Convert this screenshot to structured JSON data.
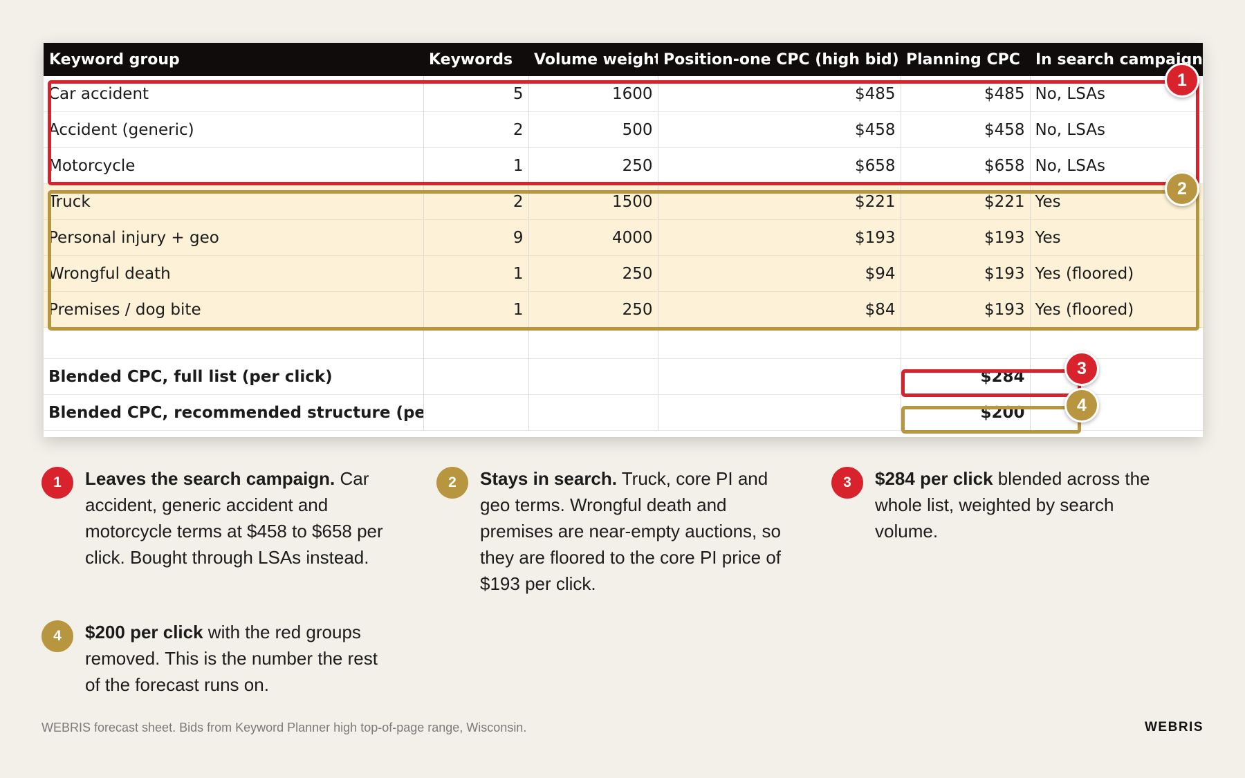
{
  "table": {
    "headers": [
      "Keyword group",
      "Keywords",
      "Volume weight",
      "Position-one CPC (high bid)",
      "Planning CPC",
      "In search campaign?"
    ],
    "rows": [
      {
        "group": "Car accident",
        "keywords": "5",
        "volume": "1600",
        "pos_cpc": "$485",
        "planning_cpc": "$485",
        "in_search": "No, LSAs"
      },
      {
        "group": "Accident (generic)",
        "keywords": "2",
        "volume": "500",
        "pos_cpc": "$458",
        "planning_cpc": "$458",
        "in_search": "No, LSAs"
      },
      {
        "group": "Motorcycle",
        "keywords": "1",
        "volume": "250",
        "pos_cpc": "$658",
        "planning_cpc": "$658",
        "in_search": "No, LSAs"
      },
      {
        "group": "Truck",
        "keywords": "2",
        "volume": "1500",
        "pos_cpc": "$221",
        "planning_cpc": "$221",
        "in_search": "Yes"
      },
      {
        "group": "Personal injury + geo",
        "keywords": "9",
        "volume": "4000",
        "pos_cpc": "$193",
        "planning_cpc": "$193",
        "in_search": "Yes"
      },
      {
        "group": "Wrongful death",
        "keywords": "1",
        "volume": "250",
        "pos_cpc": "$94",
        "planning_cpc": "$193",
        "in_search": "Yes (floored)"
      },
      {
        "group": "Premises / dog bite",
        "keywords": "1",
        "volume": "250",
        "pos_cpc": "$84",
        "planning_cpc": "$193",
        "in_search": "Yes (floored)"
      }
    ],
    "totals": [
      {
        "label": "Blended CPC, full list (per click)",
        "value": "$284"
      },
      {
        "label": "Blended CPC, recommended structure (per click)",
        "value": "$200"
      }
    ]
  },
  "markers": [
    "1",
    "2",
    "3",
    "4"
  ],
  "notes": [
    {
      "num": "1",
      "lead": "Leaves the search campaign.",
      "body": " Car accident, generic accident and motorcycle terms at $458 to $658 per click. Bought through LSAs instead."
    },
    {
      "num": "2",
      "lead": "Stays in search.",
      "body": " Truck, core PI and geo terms. Wrongful death and premises are near-empty auctions, so they are floored to the core PI price of $193 per click."
    },
    {
      "num": "3",
      "lead": "$284 per click",
      "body": " blended across the whole list, weighted by search volume."
    },
    {
      "num": "4",
      "lead": "$200 per click",
      "body": " with the red groups removed. This is the number the rest of the forecast runs on."
    }
  ],
  "footer": {
    "caption": "WEBRIS forecast sheet. Bids from Keyword Planner high top-of-page range, Wisconsin.",
    "brand": "WEBRIS"
  },
  "colors": {
    "red": "#d8232d",
    "gold": "#b8953f",
    "gold_fill": "#fdf2d7",
    "header_bg": "#100c0c",
    "page_bg": "#f3f0e9"
  }
}
